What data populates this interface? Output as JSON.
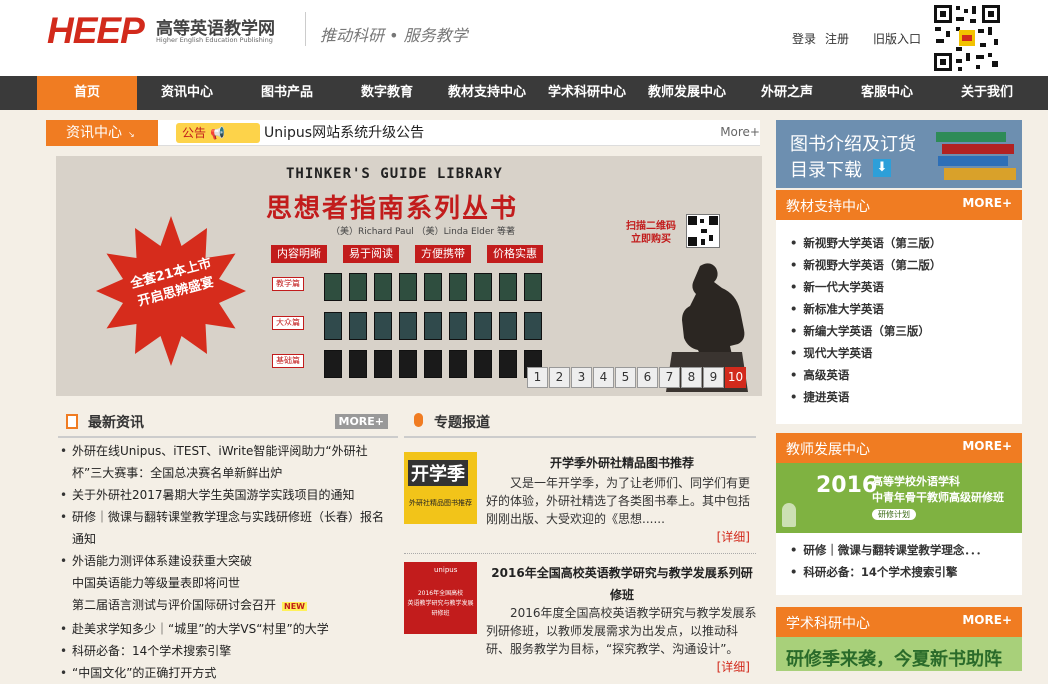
{
  "header": {
    "logo_text": "HEEP",
    "site_name": "高等英语教学网",
    "site_name_en": "Higher English Education Publishing",
    "slogan": "推动科研 • 服务教学",
    "login": "登录",
    "register": "注册",
    "old_version": "旧版入口"
  },
  "nav": [
    "首页",
    "资讯中心",
    "图书产品",
    "数字教育",
    "教材支持中心",
    "学术科研中心",
    "教师发展中心",
    "外研之声",
    "客服中心",
    "关于我们"
  ],
  "newsbar": {
    "label": "资讯中心",
    "notice_tag": "公告",
    "notice": "Unipus网站系统升级公告",
    "more": "More+"
  },
  "banner": {
    "title_en": "THINKER'S GUIDE LIBRARY",
    "title_cn": "思想者指南系列丛书",
    "authors": "（美）Richard Paul （美）Linda Elder 等著",
    "features": [
      "内容明晰",
      "易于阅读",
      "方便携带",
      "价格实惠"
    ],
    "star_line1": "全套21本上市",
    "star_line2": "开启思辨盛宴",
    "categories": [
      "教学篇",
      "大众篇",
      "基础篇"
    ],
    "qr_line1": "扫描二维码",
    "qr_line2": "立即购买",
    "pages": [
      "1",
      "2",
      "3",
      "4",
      "5",
      "6",
      "7",
      "8",
      "9",
      "10"
    ],
    "current_page": "10"
  },
  "latest": {
    "title": "最新资讯",
    "more": "MORE+",
    "items": [
      {
        "text": "外研在线Unipus、iTEST、iWrite智能评阅助力“外研社杯”三大赛事：全国总决赛名单新鲜出炉",
        "bullet": true
      },
      {
        "text": "关于外研社2017暑期大学生英国游学实践项目的通知",
        "bullet": true
      },
      {
        "text": "研修｜微课与翻转课堂教学理念与实践研修班（长春）报名通知",
        "bullet": true
      },
      {
        "text": "外语能力测评体系建设获重大突破",
        "bullet": true
      },
      {
        "text": "中国英语能力等级量表即将问世",
        "bullet": false
      },
      {
        "text": "第二届语言测试与评价国际研讨会召开",
        "bullet": false,
        "new": "NEW"
      },
      {
        "text": "赴美求学知多少｜“城里”的大学VS“村里”的大学",
        "bullet": true
      },
      {
        "text": "科研必备：14个学术搜索引擎",
        "bullet": true
      },
      {
        "text": "“中国文化”的正确打开方式",
        "bullet": true
      }
    ]
  },
  "reports": {
    "title": "专题报道",
    "img1_big": "开学季",
    "img1_small": "外研社精品图书推荐",
    "item1_title": "开学季外研社精品图书推荐",
    "item1_body": "又是一年开学季，为了让老师们、同学们有更好的体验，外研社精选了各类图书奉上。其中包括刚刚出版、大受欢迎的《思想......",
    "item1_detail": "[详细]",
    "img2_brand": "unipus",
    "img2_line1": "2016年全国高校",
    "img2_line2": "英语教学研究与教学发展",
    "img2_line3": "研修班",
    "item2_title": "2016年全国高校英语教学研究与教学发展系列研修班",
    "item2_body": "2016年度全国高校英语教学研究与教学发展系列研修班，以教师发展需求为出发点，以推动科研、服务教学为目标，“探究教学、沟通设计”。",
    "item2_detail": "[详细]"
  },
  "sidebar": {
    "book_banner_line1": "图书介绍及订货",
    "book_banner_line2": "目录下载",
    "textbook": {
      "title": "教材支持中心",
      "more": "MORE+",
      "items": [
        "新视野大学英语（第三版）",
        "新视野大学英语（第二版）",
        "新一代大学英语",
        "新标准大学英语",
        "新编大学英语（第三版）",
        "现代大学英语",
        "高级英语",
        "捷进英语"
      ]
    },
    "teacher": {
      "title": "教师发展中心",
      "more": "MORE+",
      "banner_year": "2016",
      "banner_line1": "高等学校外语学科",
      "banner_line2": "中青年骨干教师高级研修班",
      "banner_btn": "研修计划",
      "items": [
        "研修｜微课与翻转课堂教学理念．．．",
        "科研必备：14个学术搜索引擎"
      ]
    },
    "academic": {
      "title": "学术科研中心",
      "more": "MORE+",
      "banner": "研修季来袭，今夏新书助阵"
    }
  },
  "colors": {
    "brand_red": "#d22a1c",
    "accent_orange": "#f07c22",
    "nav_bg": "#3a3a3a",
    "page_bg": "#f4efe6"
  }
}
